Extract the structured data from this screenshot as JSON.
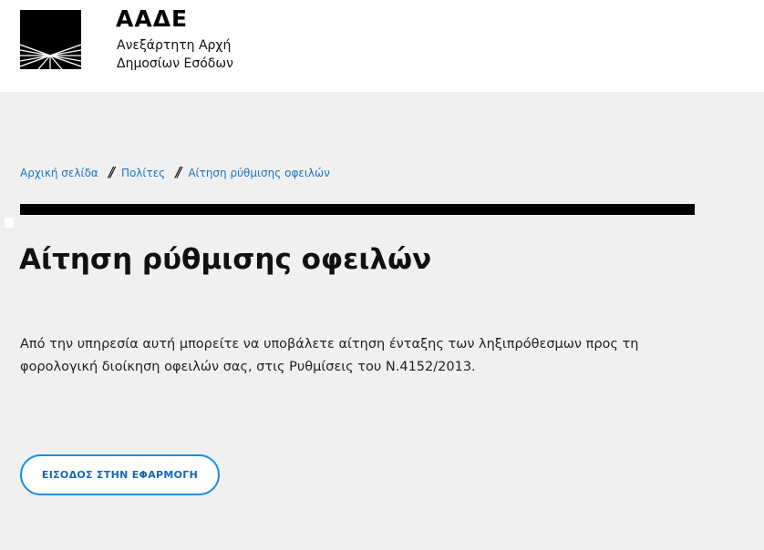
{
  "header": {
    "logo_icon": "aade-logo-icon",
    "title": "ΑΑΔΕ",
    "subtitle_line1": "Ανεξάρτητη Αρχή",
    "subtitle_line2": "Δημοσίων Εσόδων"
  },
  "breadcrumb": {
    "items": [
      {
        "label": "Αρχική σελίδα"
      },
      {
        "label": "Πολίτες"
      },
      {
        "label": "Αίτηση ρύθμισης οφειλών"
      }
    ],
    "separator": "//"
  },
  "main": {
    "title": "Αίτηση ρύθμισης οφειλών",
    "description": "Από την υπηρεσία αυτή μπορείτε να υποβάλετε αίτηση ένταξης των ληξιπρόθεσμων προς τη φορολογική διοίκηση οφειλών σας, στις Ρυθμίσεις του Ν.4152/2013.",
    "enter_button_label": "ΕΙΣΟΔΟΣ ΣΤΗΝ ΕΦΑΡΜΟΓΗ"
  },
  "colors": {
    "background": "#f0f0f0",
    "header_bg": "#ffffff",
    "link": "#1a73c8",
    "button_border": "#1a8fe6",
    "button_text": "#1468b8",
    "rule": "#000000"
  }
}
